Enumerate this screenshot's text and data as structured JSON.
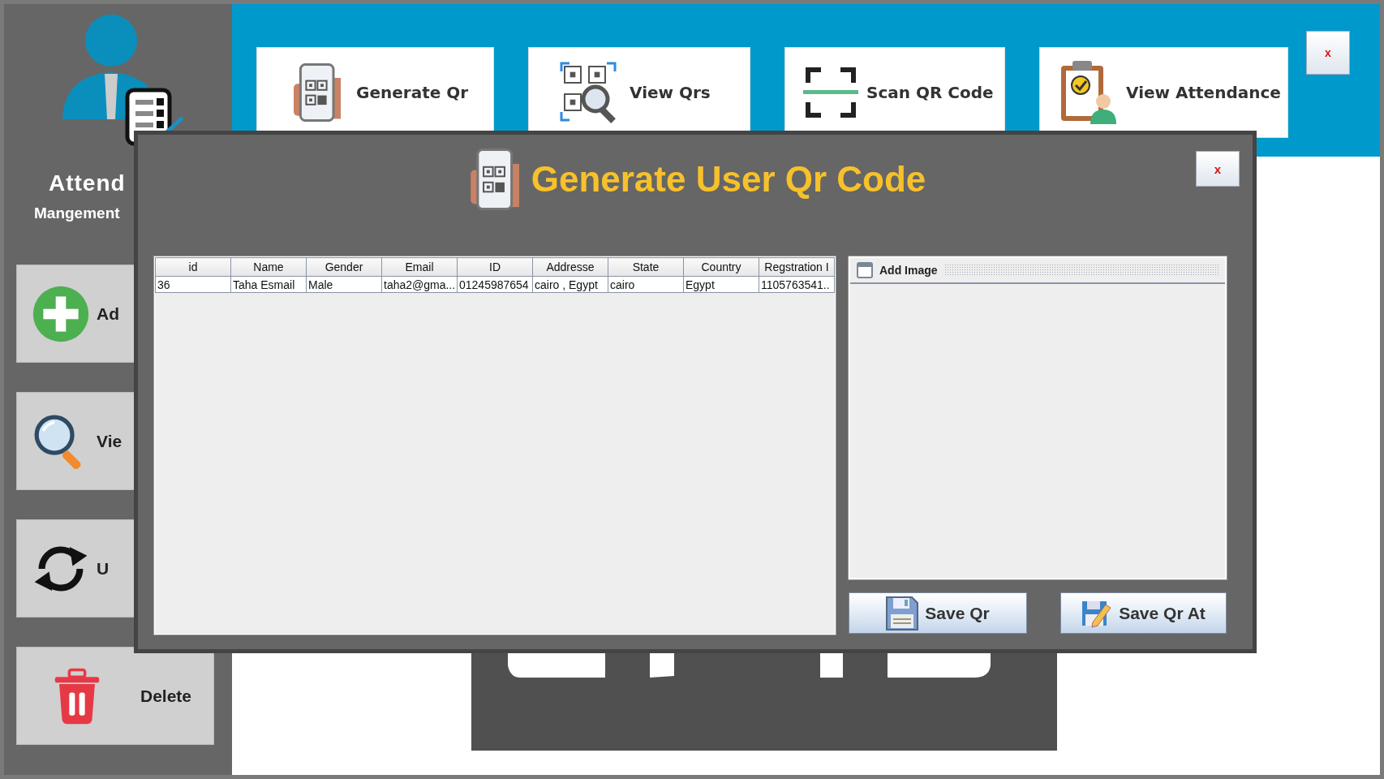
{
  "app": {
    "title": "Attend",
    "subtitle": "Mangement"
  },
  "sidebar": {
    "items": [
      {
        "label": "Ad",
        "kind": "add"
      },
      {
        "label": "Vie",
        "kind": "view"
      },
      {
        "label": "U",
        "kind": "update"
      },
      {
        "label": "Delete",
        "kind": "delete"
      }
    ]
  },
  "toolbar": {
    "items": [
      {
        "label": "Generate Qr",
        "kind": "generate"
      },
      {
        "label": "View Qrs",
        "kind": "view_qrs"
      },
      {
        "label": "Scan QR Code",
        "kind": "scan"
      },
      {
        "label": "View Attendance",
        "kind": "attendance"
      }
    ],
    "close_button": "x"
  },
  "dialog": {
    "title": "Generate User Qr Code",
    "close_button": "x",
    "table": {
      "columns": [
        "id",
        "Name",
        "Gender",
        "Email",
        "ID",
        "Addresse",
        "State",
        "Country",
        "Regstration I"
      ],
      "rows": [
        [
          "36",
          "Taha Esmail",
          "Male",
          "taha2@gma...",
          "01245987654",
          "cairo , Egypt",
          "cairo",
          "Egypt",
          "1105763541.."
        ]
      ]
    },
    "image_panel": {
      "title": "Add Image"
    },
    "buttons": [
      {
        "label": "Save Qr",
        "kind": "save"
      },
      {
        "label": "Save Qr At",
        "kind": "save_as"
      }
    ]
  }
}
